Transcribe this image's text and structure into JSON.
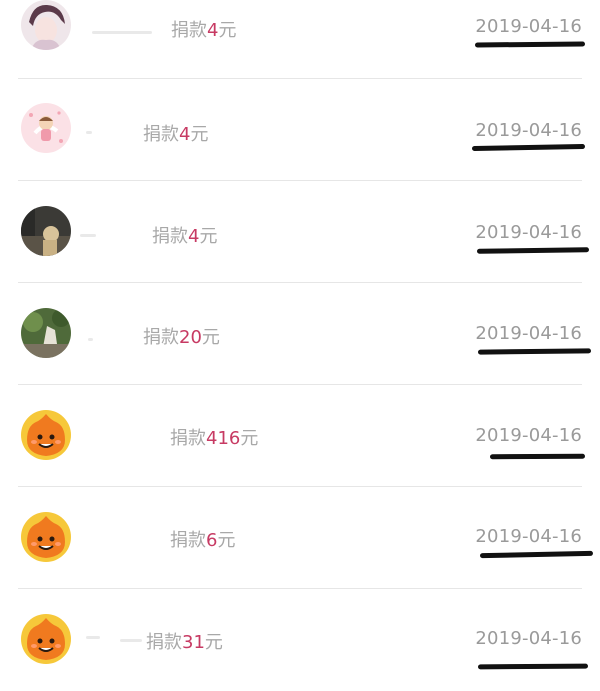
{
  "colors": {
    "amount": "#c73a63",
    "label_text": "#a8a8a8",
    "date_text": "#9a9a9a",
    "divider": "#e6e6e6",
    "background": "#ffffff"
  },
  "donations": [
    {
      "label": "捐款",
      "amount": "4",
      "unit": "元",
      "date": "2019-04-16",
      "avatar": "anime-girl-avatar"
    },
    {
      "label": "捐款",
      "amount": "4",
      "unit": "元",
      "date": "2019-04-16",
      "avatar": "pink-cartoon-avatar"
    },
    {
      "label": "捐款",
      "amount": "4",
      "unit": "元",
      "date": "2019-04-16",
      "avatar": "dark-photo-avatar"
    },
    {
      "label": "捐款",
      "amount": "20",
      "unit": "元",
      "date": "2019-04-16",
      "avatar": "nature-photo-avatar"
    },
    {
      "label": "捐款",
      "amount": "416",
      "unit": "元",
      "date": "2019-04-16",
      "avatar": "orange-mascot-avatar"
    },
    {
      "label": "捐款",
      "amount": "6",
      "unit": "元",
      "date": "2019-04-16",
      "avatar": "orange-mascot-avatar"
    },
    {
      "label": "捐款",
      "amount": "31",
      "unit": "元",
      "date": "2019-04-16",
      "avatar": "orange-mascot-avatar"
    }
  ]
}
